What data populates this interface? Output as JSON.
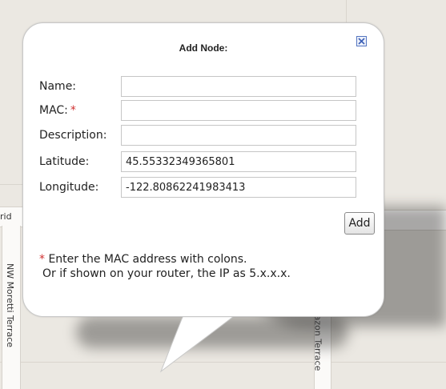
{
  "dialog": {
    "title": "Add Node:",
    "fields": [
      {
        "label": "Name:",
        "required": false,
        "value": ""
      },
      {
        "label": "MAC:",
        "required": true,
        "value": ""
      },
      {
        "label": "Description:",
        "required": false,
        "value": ""
      },
      {
        "label": "Latitude:",
        "required": false,
        "value": "45.55332349365801"
      },
      {
        "label": "Longitude:",
        "required": false,
        "value": "-122.80862241983413"
      }
    ],
    "required_marker": "*",
    "add_button": "Add",
    "note_marker": "*",
    "note_line1": "Enter the MAC address with colons.",
    "note_line2": "Or if shown on your router, the IP as 5.x.x.x."
  },
  "map": {
    "street_labels": {
      "left_vertical": "NW Moretti Terrace",
      "right_vertical": "azon Terrace",
      "left_edge": "rid"
    }
  },
  "colors": {
    "close_icon": "#3b5fb5",
    "required_star": "#d03030"
  }
}
